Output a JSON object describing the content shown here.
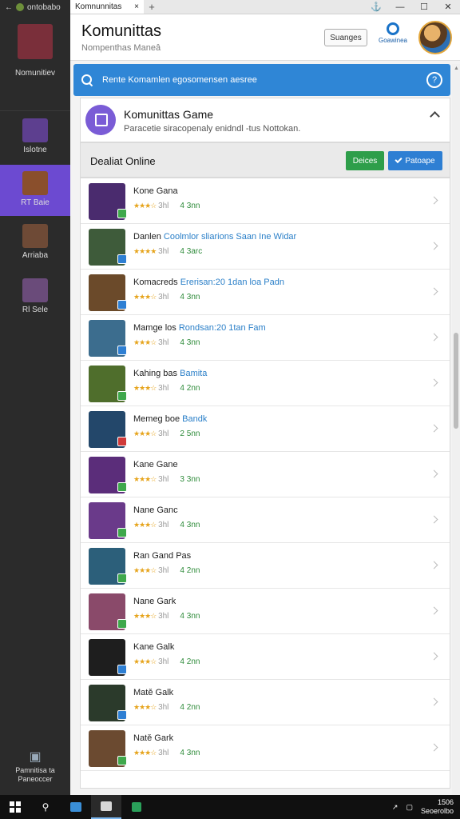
{
  "sidebar": {
    "top_label": "ontobabo",
    "header_label": "Nomunitiev",
    "items": [
      {
        "label": "Islotne",
        "color": "#5d3f8f"
      },
      {
        "label": "RT Baie",
        "color": "#8a4f2c"
      },
      {
        "label": "Arriaba",
        "color": "#6e4a36"
      },
      {
        "label": "Rl Sele",
        "color": "#6a4b7a"
      }
    ],
    "bottom_label": "Pamnitisa ta Paneoccer"
  },
  "window": {
    "tab_label": "Komnunnitas",
    "close_tab": "×",
    "new_tab": "+",
    "controls": [
      "⚓",
      "—",
      "☐",
      "✕"
    ]
  },
  "header": {
    "title": "Komunittas",
    "subtitle": "Nompenthas Maneâ",
    "settings_label": "Suanges",
    "gear_label": "Goawinea"
  },
  "search": {
    "text": "Rente Komamlen egosomensen aesree",
    "help": "?"
  },
  "card": {
    "title": "Komunittas Game",
    "subtitle": "Paracetie siracopenaly enidndl -tus Nottokan."
  },
  "section": {
    "title": "Dealiat Online",
    "green_button": "Deices",
    "blue_button": "Patoape"
  },
  "games": [
    {
      "name": "Kone Gana",
      "link": "",
      "stars": "★★★☆",
      "rating": "3hl",
      "count": "4 3nn",
      "thumb": "#4a2b6e",
      "badge": "#3fa84c"
    },
    {
      "name": "Danlen",
      "link": "Coolmlor sliarions Saan Ine Widar",
      "stars": "★★★★",
      "rating": "3hl",
      "count": "4 3arc",
      "thumb": "#3e5b3a",
      "badge": "#2e7fd3"
    },
    {
      "name": "Komacreds",
      "link": "Ererisan:20 1dan loa Padn",
      "stars": "★★★☆",
      "rating": "3hl",
      "count": "4 3nn",
      "thumb": "#6b4a2a",
      "badge": "#2e7fd3"
    },
    {
      "name": "Mamge los",
      "link": "Rondsan:20 1tan Fam",
      "stars": "★★★☆",
      "rating": "3hl",
      "count": "4 3nn",
      "thumb": "#3c6d8e",
      "badge": "#2e7fd3"
    },
    {
      "name": "Kahing bas",
      "link": "Bamita",
      "stars": "★★★☆",
      "rating": "3hl",
      "count": "4 2nn",
      "thumb": "#4f6e2c",
      "badge": "#3fa84c"
    },
    {
      "name": "Memeg boe",
      "link": "Bandk",
      "stars": "★★★☆",
      "rating": "3hl",
      "count": "2 5nn",
      "thumb": "#23476a",
      "badge": "#d03a3a"
    },
    {
      "name": "Kane Gane",
      "link": "",
      "stars": "★★★☆",
      "rating": "3hl",
      "count": "3 3nn",
      "thumb": "#5b2d7a",
      "badge": "#3fa84c"
    },
    {
      "name": "Nane Ganc",
      "link": "",
      "stars": "★★★☆",
      "rating": "3hl",
      "count": "4 3nn",
      "thumb": "#6a3a8a",
      "badge": "#3fa84c"
    },
    {
      "name": "Ran Gand Pas",
      "link": "",
      "stars": "★★★☆",
      "rating": "3hl",
      "count": "4 2nn",
      "thumb": "#2c5f7a",
      "badge": "#3fa84c"
    },
    {
      "name": "Nane Gark",
      "link": "",
      "stars": "★★★☆",
      "rating": "3hl",
      "count": "4 3nn",
      "thumb": "#8a4a6a",
      "badge": "#3fa84c"
    },
    {
      "name": "Kane Galk",
      "link": "",
      "stars": "★★★☆",
      "rating": "3hl",
      "count": "4 2nn",
      "thumb": "#1e1e1e",
      "badge": "#2e7fd3"
    },
    {
      "name": "Matě Galk",
      "link": "",
      "stars": "★★★☆",
      "rating": "3hl",
      "count": "4 2nn",
      "thumb": "#2b3a2b",
      "badge": "#2e7fd3"
    },
    {
      "name": "Natě Gark",
      "link": "",
      "stars": "★★★☆",
      "rating": "3hl",
      "count": "4 3nn",
      "thumb": "#6b4a30",
      "badge": "#3fa84c"
    }
  ],
  "taskbar": {
    "clock_line1": "1506",
    "clock_line2": "Seoerolbo"
  }
}
